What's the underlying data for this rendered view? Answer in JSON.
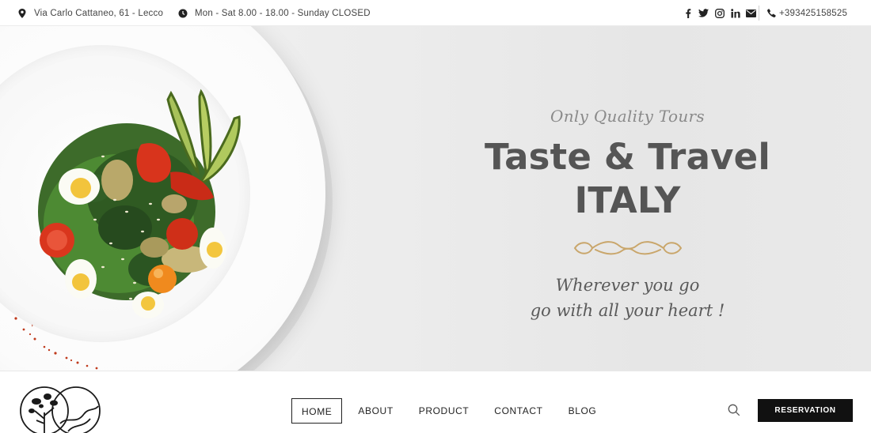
{
  "topbar": {
    "address": "Via Carlo Cattaneo, 61 - Lecco",
    "hours": "Mon - Sat 8.00 - 18.00 - Sunday CLOSED",
    "phone": "+393425158525",
    "social_icons": [
      "facebook-icon",
      "twitter-icon",
      "instagram-icon",
      "linkedin-icon",
      "mail-icon"
    ]
  },
  "hero": {
    "tagline": "Only Quality Tours",
    "headline_line1": "Taste & Travel",
    "headline_line2": "ITALY",
    "motto_line1": "Wherever you go",
    "motto_line2": "go with all your heart !",
    "ornament_color": "#c9a66b"
  },
  "nav": {
    "items": [
      {
        "label": "HOME",
        "active": true
      },
      {
        "label": "ABOUT",
        "active": false
      },
      {
        "label": "PRODUCT",
        "active": false
      },
      {
        "label": "CONTACT",
        "active": false
      },
      {
        "label": "BLOG",
        "active": false
      }
    ],
    "reservation_label": "RESERVATION"
  },
  "colors": {
    "headline": "#555555",
    "button_bg": "#111111",
    "ornament": "#c9a66b"
  }
}
